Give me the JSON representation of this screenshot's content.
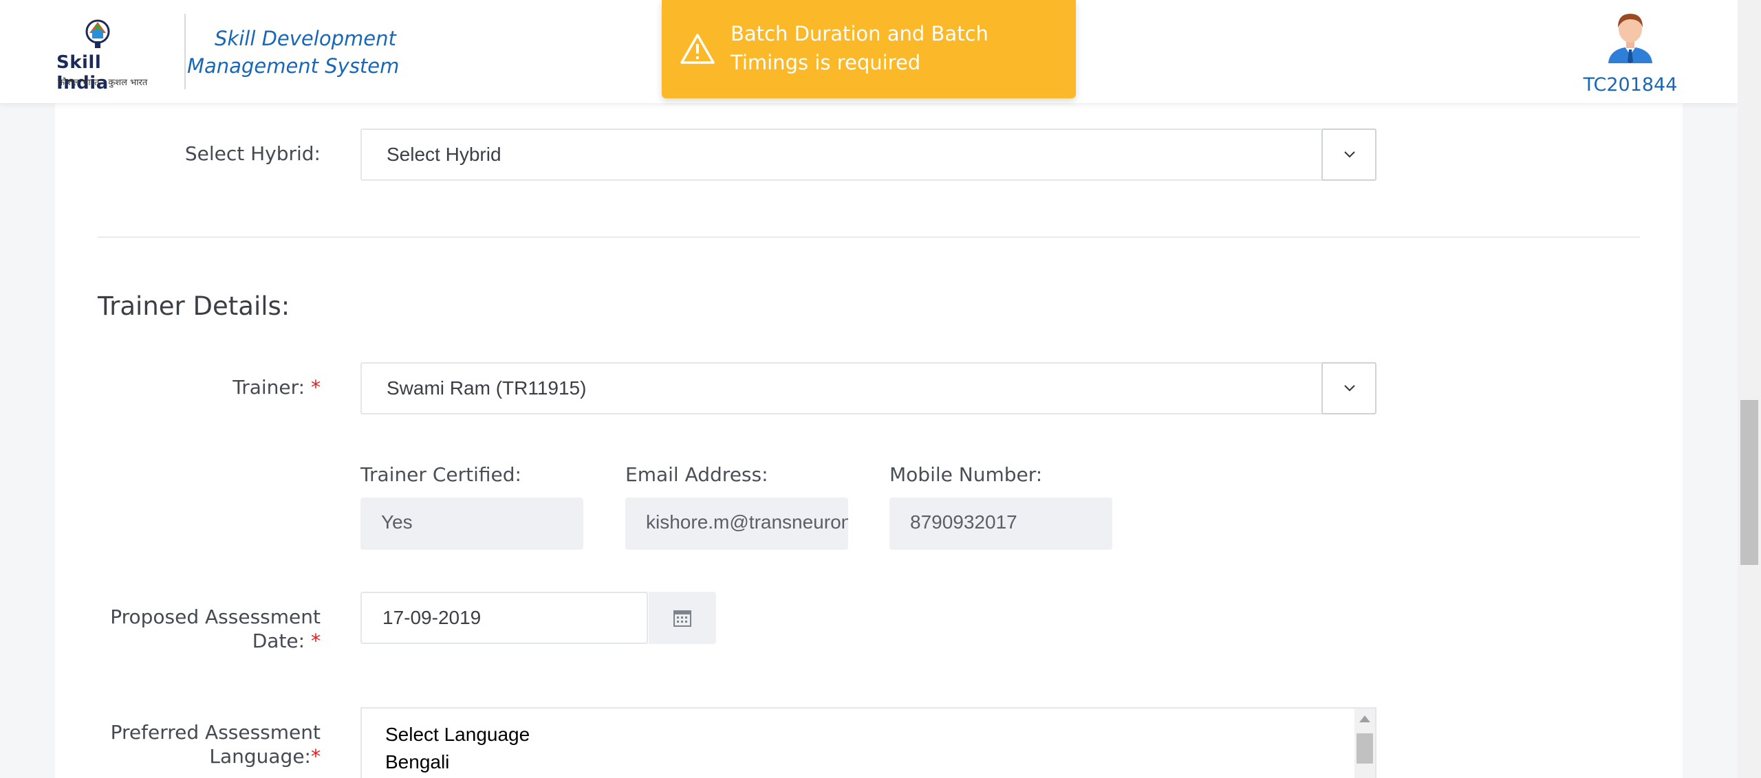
{
  "header": {
    "logo_text": "Skill India",
    "logo_subtext": "कौशल भारत - कुशल भारत",
    "app_title": "Skill Development Management System",
    "user_id": "TC201844"
  },
  "toast": {
    "message": "Batch Duration and Batch Timings is required",
    "color": "#fbb829"
  },
  "form": {
    "hybrid": {
      "label": "Select Hybrid:",
      "value": "Select Hybrid"
    },
    "section_title": "Trainer Details:",
    "trainer": {
      "label": "Trainer:",
      "required_mark": "*",
      "value": "Swami Ram (TR11915)"
    },
    "trainer_certified": {
      "label": "Trainer Certified:",
      "value": "Yes"
    },
    "email": {
      "label": "Email Address:",
      "value": "kishore.m@transneuron.com"
    },
    "mobile": {
      "label": "Mobile Number:",
      "value": "8790932017"
    },
    "assessment_date": {
      "label_line1": "Proposed Assessment",
      "label_line2": "Date:",
      "required_mark": "*",
      "value": "17-09-2019"
    },
    "assessment_language": {
      "label_line1": "Preferred Assessment",
      "label_line2": "Language:",
      "required_mark": "*",
      "options": [
        "Select Language",
        "Bengali"
      ]
    }
  },
  "colors": {
    "accent_blue": "#1868b7",
    "required_red": "#e02020"
  }
}
